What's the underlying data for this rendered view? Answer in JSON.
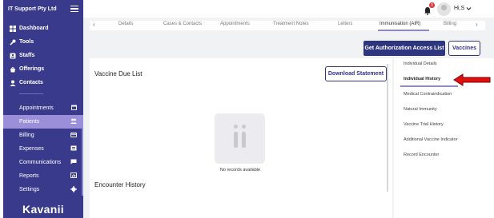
{
  "sidebar": {
    "org_name": "IT Support Pty Ltd",
    "top_items": [
      {
        "label": "Dashboard",
        "icon": "dashboard-icon"
      },
      {
        "label": "Tools",
        "icon": "wrench-icon"
      },
      {
        "label": "Staffs",
        "icon": "id-card-icon"
      },
      {
        "label": "Offerings",
        "icon": "offerings-icon"
      },
      {
        "label": "Contacts",
        "icon": "contacts-icon"
      }
    ],
    "sub_items": [
      {
        "label": "Appointments",
        "icon": "calendar-icon"
      },
      {
        "label": "Patients",
        "icon": "people-icon",
        "active": true
      },
      {
        "label": "Billing",
        "icon": "card-icon"
      },
      {
        "label": "Expenses",
        "icon": "expenses-icon"
      },
      {
        "label": "Communications",
        "icon": "chat-icon"
      },
      {
        "label": "Reports",
        "icon": "report-icon"
      },
      {
        "label": "Settings",
        "icon": "gear-icon"
      }
    ],
    "brand": "Kavanii"
  },
  "header": {
    "notification_count": "0",
    "user_initials": "Hi,S"
  },
  "tabs": [
    {
      "label": "Details"
    },
    {
      "label": "Cases & Contacts"
    },
    {
      "label": "Appointments"
    },
    {
      "label": "Treatment Notes"
    },
    {
      "label": "Letters"
    },
    {
      "label": "Immunisation (AIR)",
      "active": true
    },
    {
      "label": "Billing"
    }
  ],
  "actions": {
    "get_auth": "Get Authorization Access List",
    "vaccines": "Vaccines",
    "download": "Download Statement"
  },
  "content": {
    "vaccine_due_title": "Vaccine Due List",
    "no_records": "No records available",
    "encounter_title": "Encounter History"
  },
  "side_menu": {
    "items": [
      {
        "label": "Individual Details"
      },
      {
        "label": "Individual History",
        "active": true
      },
      {
        "label": "Medical Contraindication"
      },
      {
        "label": "Natural Immunity"
      },
      {
        "label": "Vaccine Trial History"
      },
      {
        "label": "Additional Vaccine Indicator"
      },
      {
        "label": "Record Encounter"
      }
    ]
  },
  "colors": {
    "sidebar_bg": "#3a3a8c",
    "sidebar_active": "#9b8fd9",
    "primary": "#2e3680",
    "accent_underline": "#8f86d8",
    "annotation_arrow": "#e01010"
  }
}
